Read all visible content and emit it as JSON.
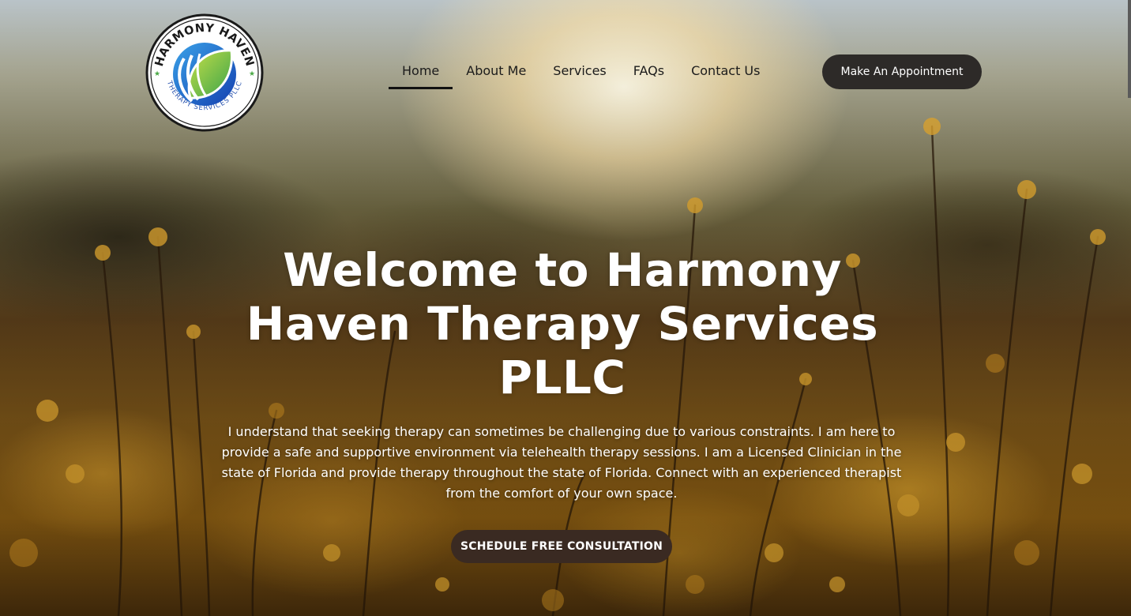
{
  "brand": {
    "name_top": "HARMONY HAVEN",
    "name_bottom": "THERAPY SERVICES PLLC",
    "logo_icon": "leaf-wave-icon",
    "colors": {
      "blue": "#1d56c8",
      "green": "#7cc242",
      "ring": "#1a1a1a"
    }
  },
  "nav": {
    "items": [
      {
        "label": "Home",
        "active": true
      },
      {
        "label": "About Me",
        "active": false
      },
      {
        "label": "Services",
        "active": false
      },
      {
        "label": "FAQs",
        "active": false
      },
      {
        "label": "Contact Us",
        "active": false
      }
    ],
    "appointment_label": "Make An Appointment"
  },
  "hero": {
    "headline": "Welcome to Harmony Haven Therapy Services PLLC",
    "intro": "I understand  that seeking therapy can sometimes be challenging due to various constraints. I am here to provide a safe and supportive environment via telehealth therapy sessions. I am a Licensed Clinician in the state of Florida and provide therapy throughout the state of Florida. Connect with an experienced therapist from the comfort of your  own space.",
    "cta_label": "SCHEDULE FREE CONSULTATION"
  },
  "colors": {
    "button_dark": "#2d2a28",
    "cta_bg": "#3a2a22",
    "text_white": "#ffffff",
    "nav_text": "#1b1b1b"
  }
}
